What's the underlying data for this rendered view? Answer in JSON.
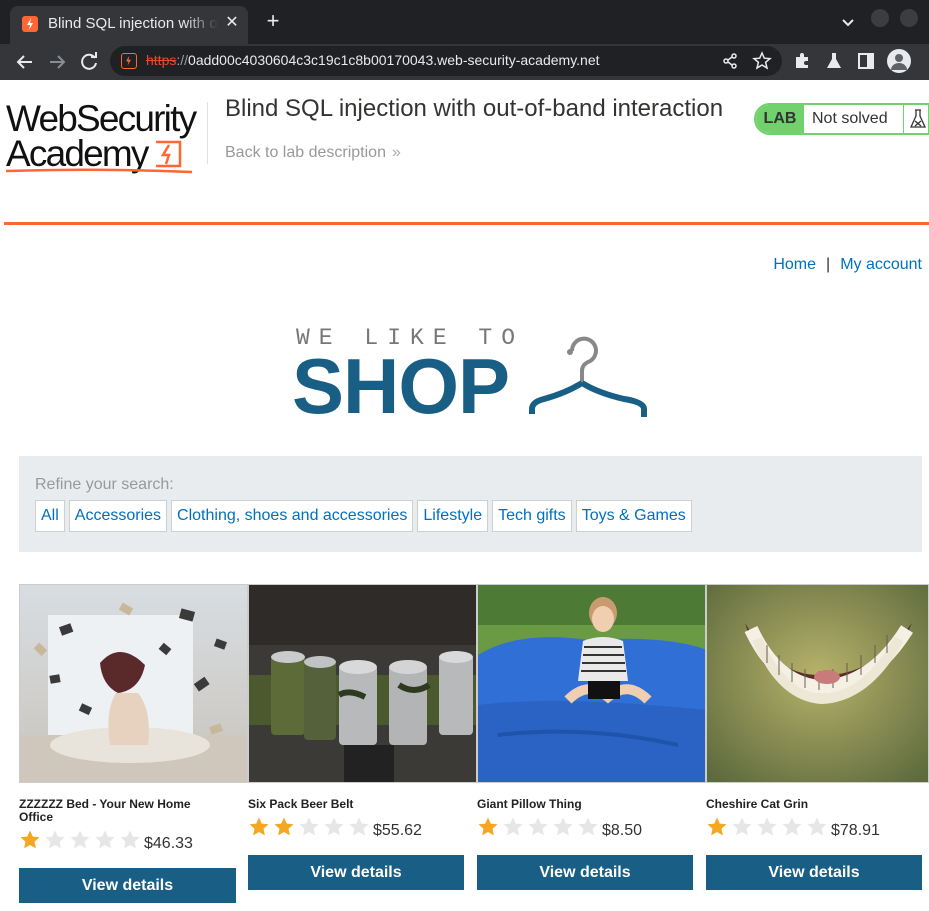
{
  "browser": {
    "tab_title": "Blind SQL injection with out-of-band interaction",
    "url_scheme": "https",
    "url_sep": "://",
    "url_host": "0add00c4030604c3c19c1c8b00170043.web-security-academy.net"
  },
  "academy": {
    "logo_line1": "WebSecurity",
    "logo_line2": "Academy",
    "lab_title": "Blind SQL injection with out-of-band interaction",
    "back_link": "Back to lab description",
    "lab_tag": "LAB",
    "lab_state": "Not solved",
    "brand_color": "#ff6633",
    "status_color": "#70d16d"
  },
  "nav": {
    "home": "Home",
    "separator": "|",
    "account": "My account"
  },
  "banner": {
    "tagline": "WE LIKE TO",
    "headline": "SHOP"
  },
  "filters": {
    "label": "Refine your search:",
    "items": [
      "All",
      "Accessories",
      "Clothing, shoes and accessories",
      "Lifestyle",
      "Tech gifts",
      "Toys & Games"
    ]
  },
  "products": [
    {
      "name": "ZZZZZZ Bed - Your New Home Office",
      "rating": 1,
      "price": "$46.33",
      "button": "View details"
    },
    {
      "name": "Six Pack Beer Belt",
      "rating": 2,
      "price": "$55.62",
      "button": "View details"
    },
    {
      "name": "Giant Pillow Thing",
      "rating": 1,
      "price": "$8.50",
      "button": "View details"
    },
    {
      "name": "Cheshire Cat Grin",
      "rating": 1,
      "price": "$78.91",
      "button": "View details"
    }
  ]
}
